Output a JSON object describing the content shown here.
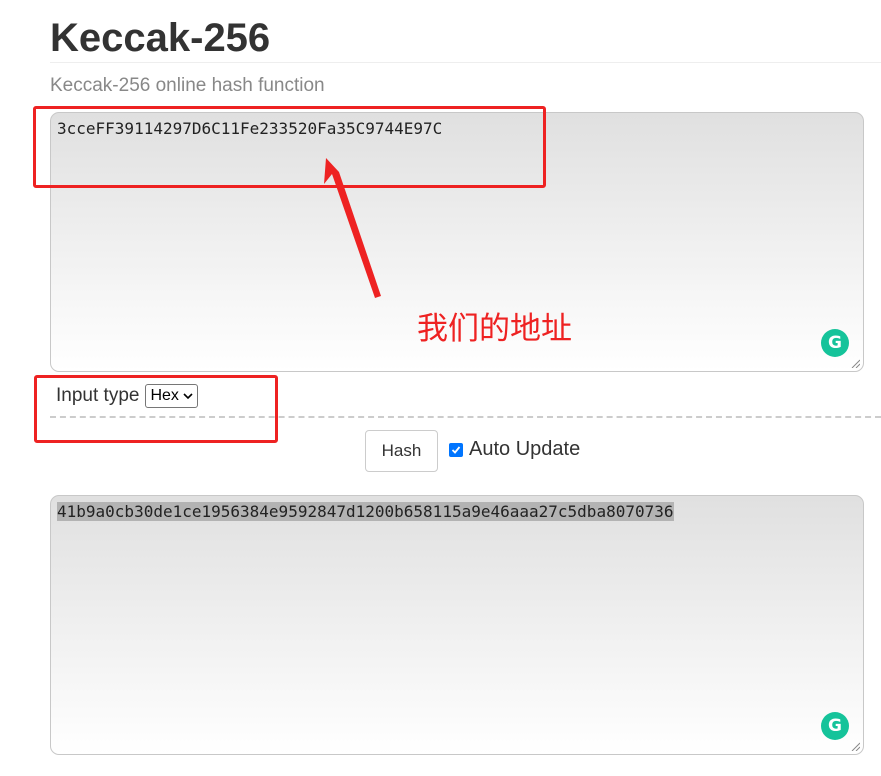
{
  "page": {
    "title": "Keccak-256",
    "subtitle": "Keccak-256 online hash function"
  },
  "input": {
    "value": "3cceFF39114297D6C11Fe233520Fa35C9744E97C"
  },
  "input_type": {
    "label": "Input type",
    "selected": "Hex"
  },
  "controls": {
    "hash_button": "Hash",
    "auto_update_label": "Auto Update",
    "auto_update_checked": true
  },
  "output": {
    "value": "41b9a0cb30de1ce1956384e9592847d1200b658115a9e46aaa27c5dba8070736"
  },
  "annotation": {
    "label": "我们的地址",
    "color": "#ee2222"
  },
  "icons": {
    "grammarly": "G",
    "grammarly_color": "#15c39a"
  }
}
